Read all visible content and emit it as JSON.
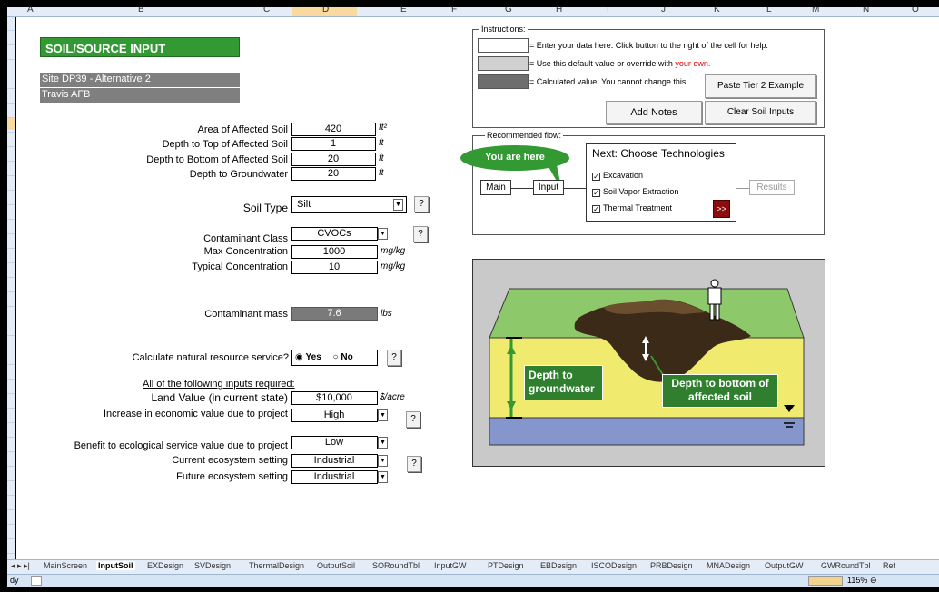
{
  "columns": [
    "A",
    "B",
    "C",
    "D",
    "E",
    "F",
    "G",
    "H",
    "I",
    "J",
    "K",
    "L",
    "M",
    "N",
    "O"
  ],
  "selected_column": "D",
  "title": "SOIL/SOURCE INPUT",
  "site_name": "Site DP39 - Alternative 2",
  "site_base": "Travis AFB",
  "fields": {
    "area_label": "Area of Affected Soil",
    "area_value": "420",
    "area_unit": "ft²",
    "top_label": "Depth to Top of Affected Soil",
    "top_value": "1",
    "top_unit": "ft",
    "bottom_label": "Depth to Bottom of Affected Soil",
    "bottom_value": "20",
    "bottom_unit": "ft",
    "gw_label": "Depth to Groundwater",
    "gw_value": "20",
    "gw_unit": "ft",
    "soil_type_label": "Soil Type",
    "soil_type_value": "Silt",
    "contam_class_label": "Contaminant Class",
    "contam_class_value": "CVOCs",
    "max_conc_label": "Max Concentration",
    "max_conc_value": "1000",
    "max_conc_unit": "mg/kg",
    "typ_conc_label": "Typical Concentration",
    "typ_conc_value": "10",
    "typ_conc_unit": "mg/kg",
    "mass_label": "Contaminant mass",
    "mass_value": "7.6",
    "mass_unit": "lbs",
    "nrs_label": "Calculate natural resource service?",
    "nrs_yes": "Yes",
    "nrs_no": "No",
    "required_note": "All of the following inputs required:",
    "land_label": "Land Value (in current state)",
    "land_value": "$10,000",
    "land_unit": "$/acre",
    "econ_label": "Increase in economic value due to project",
    "econ_value": "High",
    "eco_label": "Benefit to ecological service value due to project",
    "eco_value": "Low",
    "cur_label": "Current ecosystem setting",
    "cur_value": "Industrial",
    "fut_label": "Future ecosystem setting",
    "fut_value": "Industrial"
  },
  "help_glyph": "?",
  "dropdown_glyph": "▼",
  "instructions": {
    "title": "Instructions:",
    "line1": "= Enter your data here.  Click button to the right of the cell for help.",
    "line2": "= Use this default value or override with",
    "line2_red": "your own.",
    "line3": "= Calculated value. You cannot change this.",
    "paste_btn": "Paste Tier 2 Example",
    "notes_btn": "Add Notes",
    "clear_btn": "Clear Soil Inputs"
  },
  "flow": {
    "title": "Recommended flow:",
    "you_are_here": "You are here",
    "main": "Main",
    "input": "Input",
    "next": "Next:  Choose Technologies",
    "tech1": "Excavation",
    "tech2": "Soil Vapor Extraction",
    "tech3": "Thermal Treatment",
    "go": ">>",
    "results": "Results",
    "check": "✓"
  },
  "diagram": {
    "gw_label": "Depth to groundwater",
    "bottom_label": "Depth to bottom of affected soil"
  },
  "tabs": [
    "MainScreen",
    "InputSoil",
    "EXDesign",
    "SVDesign",
    "ThermalDesign",
    "OutputSoil",
    "SORoundTbl",
    "InputGW",
    "PTDesign",
    "EBDesign",
    "ISCODesign",
    "PRBDesign",
    "MNADesign",
    "OutputGW",
    "GWRoundTbl",
    "Ref"
  ],
  "active_tab": "InputSoil",
  "status": {
    "ready": "dy",
    "zoom": "115%"
  }
}
